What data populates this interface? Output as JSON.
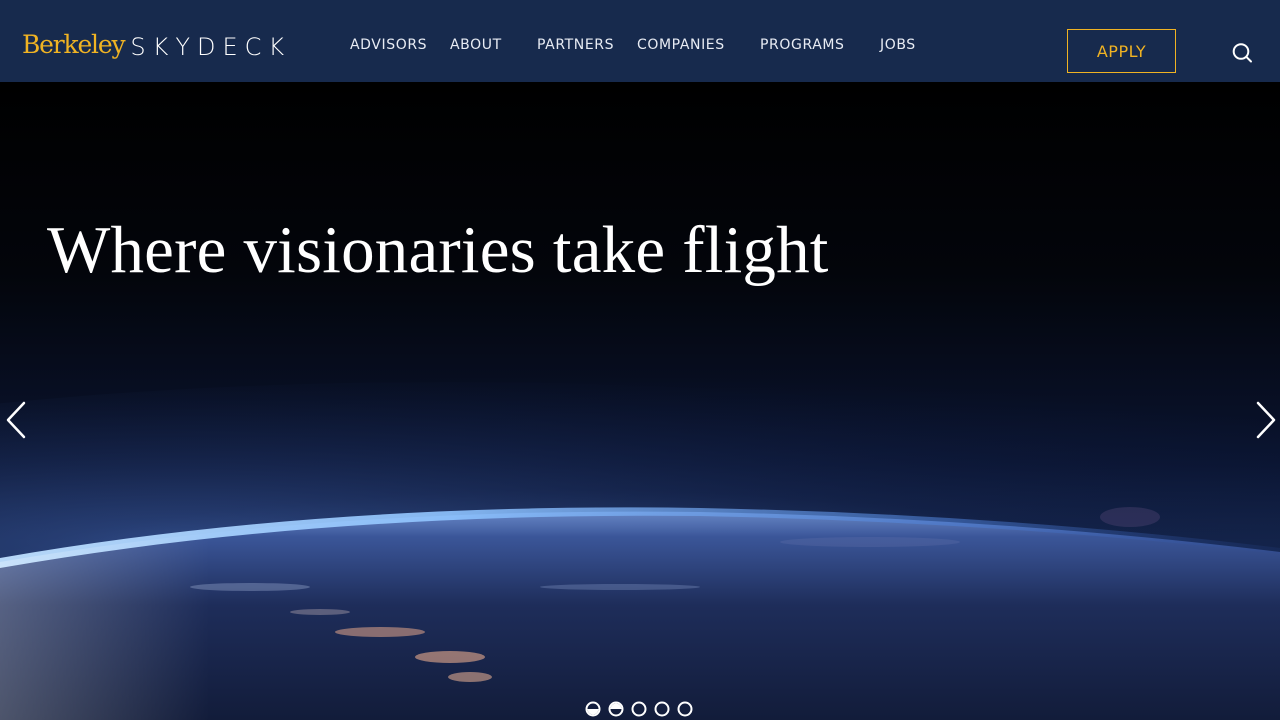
{
  "brand": {
    "berkeley": "Berkeley",
    "skydeck": "SKYDECK",
    "gold": "#f0b323",
    "navy": "#172a4d"
  },
  "nav": {
    "items": [
      {
        "label": "ADVISORS"
      },
      {
        "label": "ABOUT"
      },
      {
        "label": "PARTNERS"
      },
      {
        "label": "COMPANIES"
      },
      {
        "label": "PROGRAMS"
      },
      {
        "label": "JOBS"
      }
    ],
    "apply_label": "APPLY",
    "search_icon": "search-icon"
  },
  "hero": {
    "title": "Where visionaries take flight",
    "prev_icon": "chevron-left-icon",
    "next_icon": "chevron-right-icon"
  },
  "carousel": {
    "slide_count": 5,
    "active_index": 1
  }
}
